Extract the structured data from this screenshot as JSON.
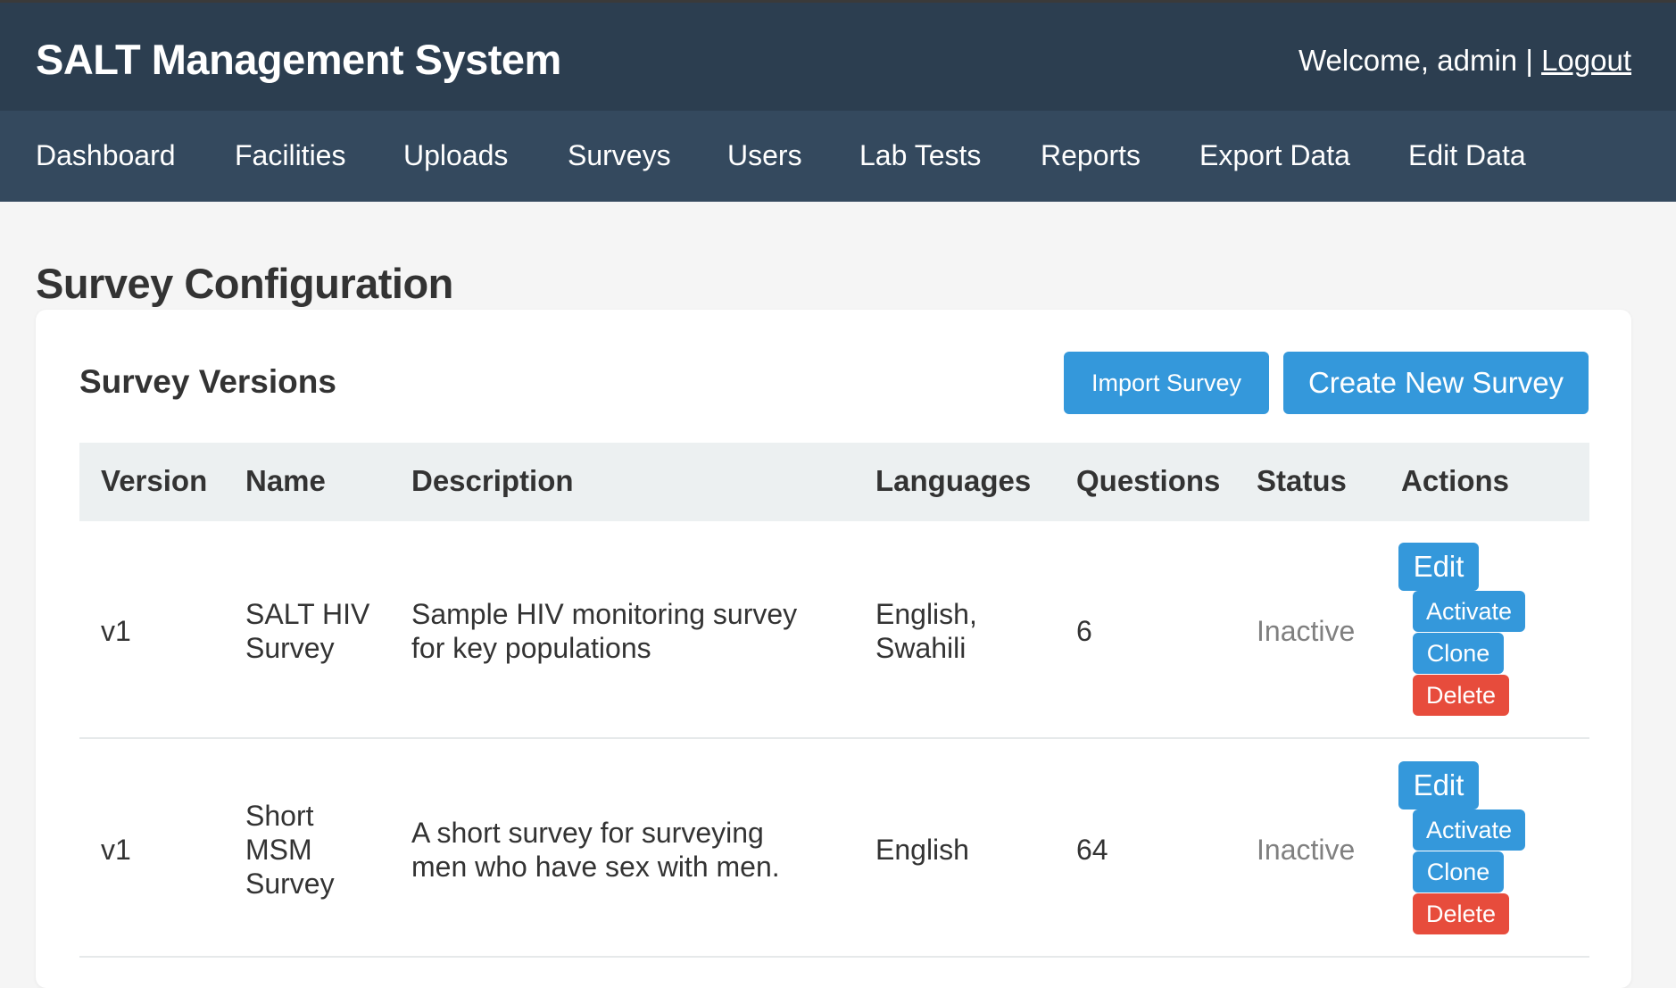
{
  "header": {
    "title": "SALT Management System",
    "welcome": "Welcome, admin",
    "separator": "|",
    "logout": "Logout"
  },
  "nav": {
    "items": [
      "Dashboard",
      "Facilities",
      "Uploads",
      "Surveys",
      "Users",
      "Lab Tests",
      "Reports",
      "Export Data",
      "Edit Data"
    ]
  },
  "page": {
    "title": "Survey Configuration"
  },
  "card": {
    "title": "Survey Versions",
    "import_label": "Import Survey",
    "create_label": "Create New Survey"
  },
  "table": {
    "headers": [
      "Version",
      "Name",
      "Description",
      "Languages",
      "Questions",
      "Status",
      "Actions"
    ],
    "rows": [
      {
        "version": "v1",
        "name": [
          "SALT HIV",
          "Survey"
        ],
        "description": [
          "Sample HIV monitoring survey",
          "for key populations"
        ],
        "languages": [
          "English,",
          "Swahili"
        ],
        "questions": "6",
        "status": "Inactive",
        "actions": [
          "Edit",
          "Activate",
          "Clone",
          "Delete"
        ]
      },
      {
        "version": "v1",
        "name": [
          "Short",
          "MSM",
          "Survey"
        ],
        "description": [
          "A short survey for surveying",
          "men who have sex with men."
        ],
        "languages": [
          "English"
        ],
        "questions": "64",
        "status": "Inactive",
        "actions": [
          "Edit",
          "Activate",
          "Clone",
          "Delete"
        ]
      }
    ]
  },
  "colors": {
    "header_bg": "#2c3e50",
    "nav_bg": "#34495e",
    "primary": "#3498db",
    "danger": "#e74c3c",
    "table_header_bg": "#ecf0f1"
  }
}
